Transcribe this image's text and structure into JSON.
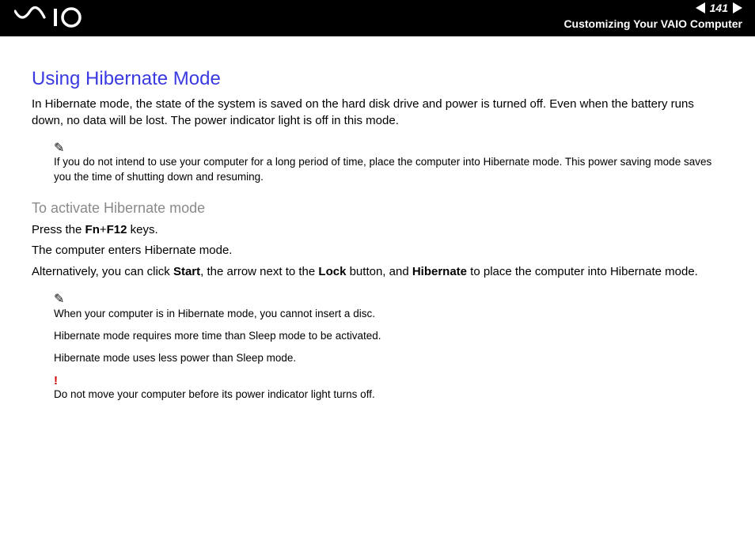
{
  "header": {
    "page_number": "141",
    "section_title": "Customizing Your VAIO Computer"
  },
  "body": {
    "title": "Using Hibernate Mode",
    "intro": "In Hibernate mode, the state of the system is saved on the hard disk drive and power is turned off. Even when the battery runs down, no data will be lost. The power indicator light is off in this mode.",
    "note1": "If you do not intend to use your computer for a long period of time, place the computer into Hibernate mode. This power saving mode saves you the time of shutting down and resuming.",
    "subheading": "To activate Hibernate mode",
    "p1_a": "Press the ",
    "p1_b": "Fn",
    "p1_c": "+",
    "p1_d": "F12",
    "p1_e": " keys.",
    "p2": "The computer enters Hibernate mode.",
    "p3_a": "Alternatively, you can click ",
    "p3_b": "Start",
    "p3_c": ", the arrow next to the ",
    "p3_d": "Lock",
    "p3_e": " button, and ",
    "p3_f": "Hibernate",
    "p3_g": " to place the computer into Hibernate mode.",
    "note2a": "When your computer is in Hibernate mode, you cannot insert a disc.",
    "note2b": "Hibernate mode requires more time than Sleep mode to be activated.",
    "note2c": "Hibernate mode uses less power than Sleep mode.",
    "warn": "Do not move your computer before its power indicator light turns off."
  },
  "icons": {
    "pencil": "✎",
    "bang": "!"
  }
}
